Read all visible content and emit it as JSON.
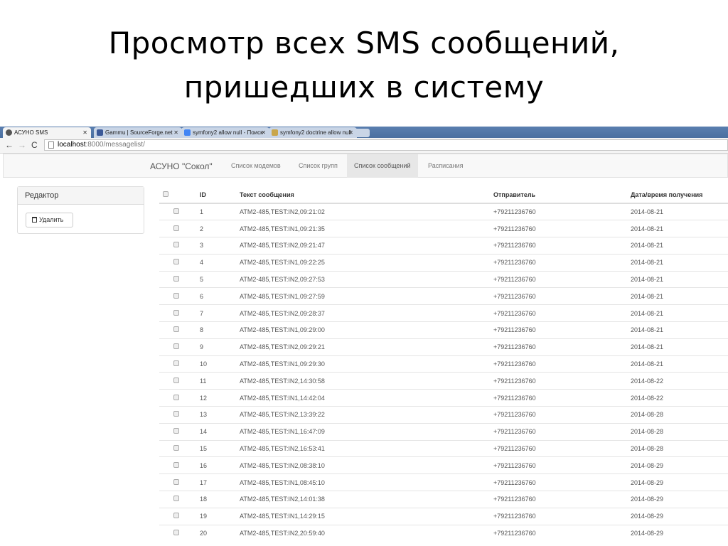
{
  "slide": {
    "title_line1": "Просмотр всех SMS сообщений,",
    "title_line2": "пришедших в систему"
  },
  "browser": {
    "tabs": [
      {
        "label": "АСУНО SMS",
        "active": true
      },
      {
        "label": "Gammu | SourceForge.net",
        "active": false
      },
      {
        "label": "symfony2 allow null - Поиск",
        "active": false
      },
      {
        "label": "symfony2 doctrine allow null",
        "active": false
      }
    ],
    "url_host": "localhost",
    "url_path": ":8000/messagelist/"
  },
  "navbar": {
    "brand": "АСУНО \"Сокол\"",
    "links": [
      {
        "label": "Список модемов",
        "active": false
      },
      {
        "label": "Список групп",
        "active": false
      },
      {
        "label": "Список сообщений",
        "active": true
      },
      {
        "label": "Расписания",
        "active": false
      }
    ]
  },
  "editor": {
    "title": "Редактор",
    "delete_label": "Удалить"
  },
  "table": {
    "headers": {
      "id": "ID",
      "text": "Текст сообщения",
      "sender": "Отправитель",
      "date": "Дата/время получения"
    },
    "rows": [
      {
        "id": "1",
        "text": "ATM2-485,TEST:IN2,09:21:02",
        "sender": "+79211236760",
        "date": "2014-08-21"
      },
      {
        "id": "2",
        "text": "ATM2-485,TEST:IN1,09:21:35",
        "sender": "+79211236760",
        "date": "2014-08-21"
      },
      {
        "id": "3",
        "text": "ATM2-485,TEST:IN2,09:21:47",
        "sender": "+79211236760",
        "date": "2014-08-21"
      },
      {
        "id": "4",
        "text": "ATM2-485,TEST:IN1,09:22:25",
        "sender": "+79211236760",
        "date": "2014-08-21"
      },
      {
        "id": "5",
        "text": "ATM2-485,TEST:IN2,09:27:53",
        "sender": "+79211236760",
        "date": "2014-08-21"
      },
      {
        "id": "6",
        "text": "ATM2-485,TEST:IN1,09:27:59",
        "sender": "+79211236760",
        "date": "2014-08-21"
      },
      {
        "id": "7",
        "text": "ATM2-485,TEST:IN2,09:28:37",
        "sender": "+79211236760",
        "date": "2014-08-21"
      },
      {
        "id": "8",
        "text": "ATM2-485,TEST:IN1,09:29:00",
        "sender": "+79211236760",
        "date": "2014-08-21"
      },
      {
        "id": "9",
        "text": "ATM2-485,TEST:IN2,09:29:21",
        "sender": "+79211236760",
        "date": "2014-08-21"
      },
      {
        "id": "10",
        "text": "ATM2-485,TEST:IN1,09:29:30",
        "sender": "+79211236760",
        "date": "2014-08-21"
      },
      {
        "id": "11",
        "text": "ATM2-485,TEST:IN2,14:30:58",
        "sender": "+79211236760",
        "date": "2014-08-22"
      },
      {
        "id": "12",
        "text": "ATM2-485,TEST:IN1,14:42:04",
        "sender": "+79211236760",
        "date": "2014-08-22"
      },
      {
        "id": "13",
        "text": "ATM2-485,TEST:IN2,13:39:22",
        "sender": "+79211236760",
        "date": "2014-08-28"
      },
      {
        "id": "14",
        "text": "ATM2-485,TEST:IN1,16:47:09",
        "sender": "+79211236760",
        "date": "2014-08-28"
      },
      {
        "id": "15",
        "text": "ATM2-485,TEST:IN2,16:53:41",
        "sender": "+79211236760",
        "date": "2014-08-28"
      },
      {
        "id": "16",
        "text": "ATM2-485,TEST:IN2,08:38:10",
        "sender": "+79211236760",
        "date": "2014-08-29"
      },
      {
        "id": "17",
        "text": "ATM2-485,TEST:IN1,08:45:10",
        "sender": "+79211236760",
        "date": "2014-08-29"
      },
      {
        "id": "18",
        "text": "ATM2-485,TEST:IN2,14:01:38",
        "sender": "+79211236760",
        "date": "2014-08-29"
      },
      {
        "id": "19",
        "text": "ATM2-485,TEST:IN1,14:29:15",
        "sender": "+79211236760",
        "date": "2014-08-29"
      },
      {
        "id": "20",
        "text": "ATM2-485,TEST:IN2,20:59:40",
        "sender": "+79211236760",
        "date": "2014-08-29"
      }
    ]
  }
}
